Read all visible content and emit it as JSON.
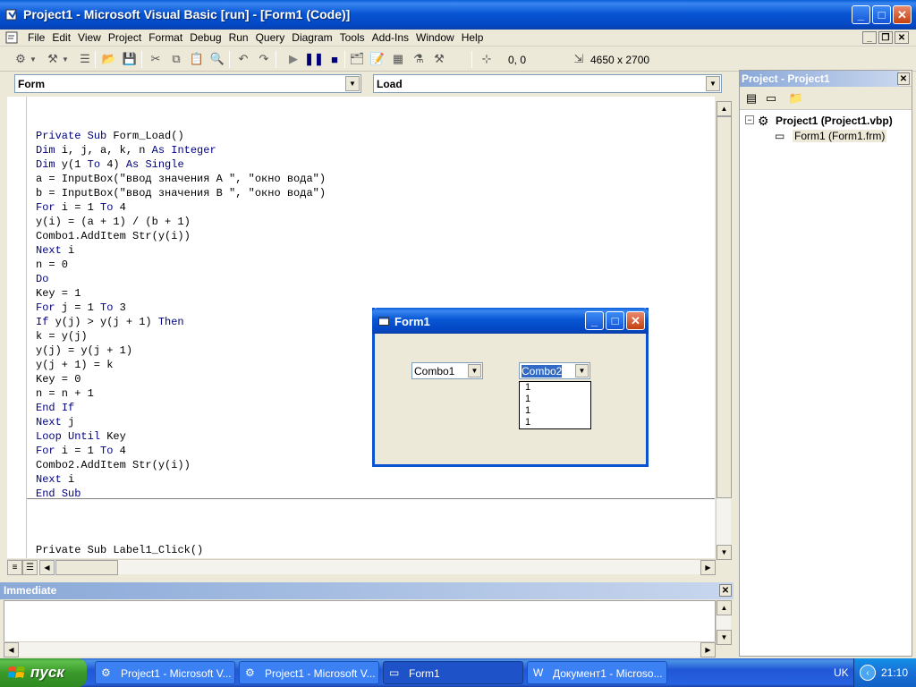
{
  "window": {
    "title": "Project1 - Microsoft Visual Basic [run] - [Form1 (Code)]"
  },
  "menu": [
    "File",
    "Edit",
    "View",
    "Project",
    "Format",
    "Debug",
    "Run",
    "Query",
    "Diagram",
    "Tools",
    "Add-Ins",
    "Window",
    "Help"
  ],
  "toolbar": {
    "position": "0, 0",
    "size": "4650 x 2700"
  },
  "code_window": {
    "object_combo": "Form",
    "procedure_combo": "Load",
    "lines": [
      "Private Sub Form_Load()",
      "Dim i, j, a, k, n As Integer",
      "Dim y(1 To 4) As Single",
      "a = InputBox(\"ввод значения A \", \"окно вода\")",
      "b = InputBox(\"ввод значения B \", \"окно вода\")",
      "For i = 1 To 4",
      "y(i) = (a + 1) / (b + 1)",
      "Combo1.AddItem Str(y(i))",
      "Next i",
      "n = 0",
      "Do",
      "Key = 1",
      "For j = 1 To 3",
      "If y(j) > y(j + 1) Then",
      "k = y(j)",
      "y(j) = y(j + 1)",
      "y(j + 1) = k",
      "Key = 0",
      "n = n + 1",
      "End If",
      "Next j",
      "Loop Until Key",
      "For i = 1 To 4",
      "Combo2.AddItem Str(y(i))",
      "Next i",
      "End Sub"
    ],
    "next_proc": "Private Sub Label1_Click()"
  },
  "project_explorer": {
    "title": "Project - Project1",
    "project_node": "Project1 (Project1.vbp)",
    "form_node": "Form1 (Form1.frm)"
  },
  "immediate": {
    "title": "Immediate"
  },
  "form1": {
    "title": "Form1",
    "combo1": "Combo1",
    "combo2": "Combo2",
    "dropdown_items": [
      "1",
      "1",
      "1",
      "1"
    ]
  },
  "taskbar": {
    "start": "пуск",
    "tasks": [
      "Project1 - Microsoft V...",
      "Project1 - Microsoft V...",
      "Form1",
      "Документ1 - Microso..."
    ],
    "lang": "UK",
    "time": "21:10"
  },
  "colors": {
    "keyword": "#00007f",
    "xp_blue": "#0a52d0",
    "start_green": "#3a9a2a"
  }
}
